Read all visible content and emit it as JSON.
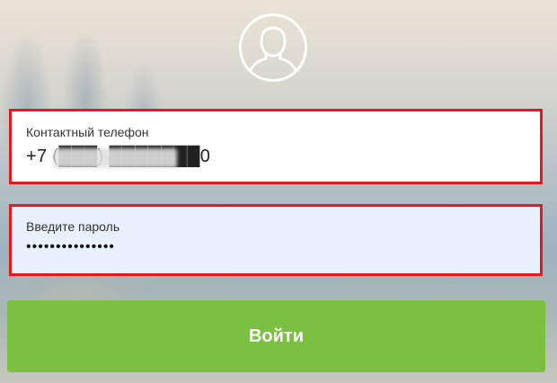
{
  "login": {
    "avatar_icon": "user-silhouette-icon",
    "phone": {
      "label": "Контактный телефон",
      "value": "+7 (███) ███████0"
    },
    "password": {
      "label": "Введите пароль",
      "value": "•••••••••••••••"
    },
    "submit_label": "Войти"
  },
  "colors": {
    "highlight_border": "#e8171b",
    "button_green": "#7cc043",
    "password_bg": "#e8f0fe"
  }
}
